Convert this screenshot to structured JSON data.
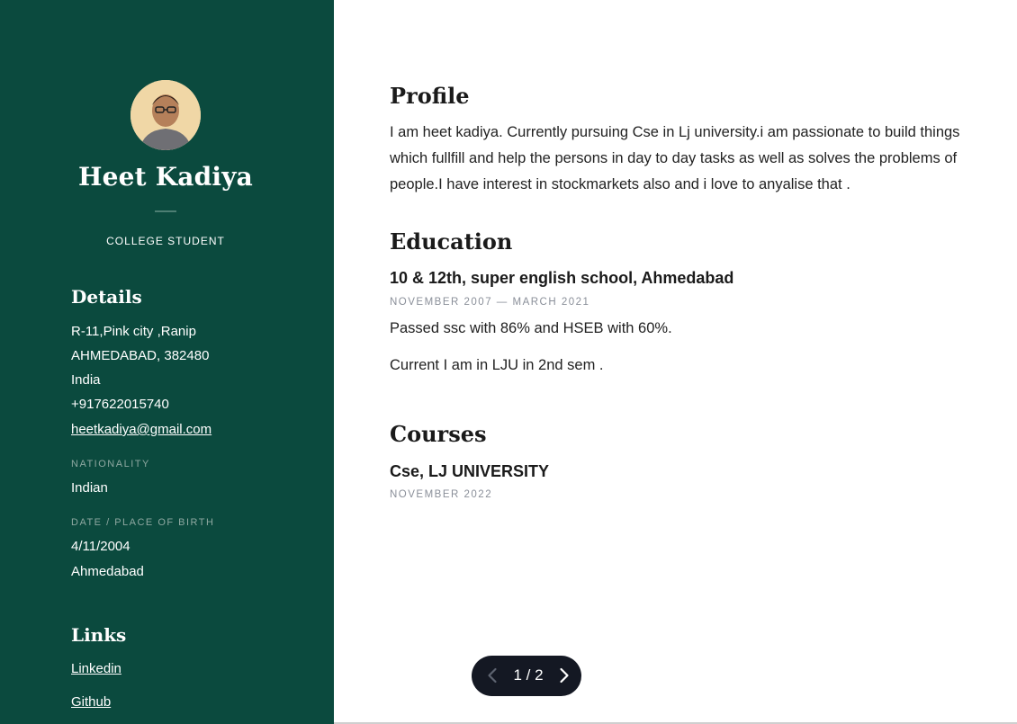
{
  "profile": {
    "name": "Heet Kadiya",
    "role": "COLLEGE STUDENT"
  },
  "details": {
    "heading": "Details",
    "address_line1": "R-11,Pink city ,Ranip",
    "address_line2": "AHMEDABAD, 382480",
    "country": "India",
    "phone": "+917622015740",
    "email": "heetkadiya@gmail.com",
    "nationality_label": "NATIONALITY",
    "nationality": "Indian",
    "birth_label": "DATE / PLACE OF BIRTH",
    "birth_date": "4/11/2004",
    "birth_place": "Ahmedabad"
  },
  "links": {
    "heading": "Links",
    "items": [
      "Linkedin",
      "Github"
    ]
  },
  "sections": {
    "profile_heading": "Profile",
    "profile_text": "I am heet kadiya. Currently pursuing Cse in Lj university.i am passionate to build things which fullfill and help the persons in day to day tasks as well as solves the problems of people.I have interest in stockmarkets also and i love to anyalise that .",
    "education_heading": "Education",
    "education_title": "10 & 12th, super english school, Ahmedabad",
    "education_date": "NOVEMBER 2007 — MARCH 2021",
    "education_line1": "Passed ssc with 86% and HSEB with 60%.",
    "education_line2": "Current I am in LJU in 2nd sem .",
    "courses_heading": "Courses",
    "course_title": "Cse, LJ UNIVERSITY",
    "course_date": "NOVEMBER 2022"
  },
  "pager": {
    "count": "1 / 2",
    "prev_icon": "chevron-left-icon",
    "next_icon": "chevron-right-icon"
  },
  "colors": {
    "sidebar": "#0b4a3e",
    "pager": "#141823"
  }
}
